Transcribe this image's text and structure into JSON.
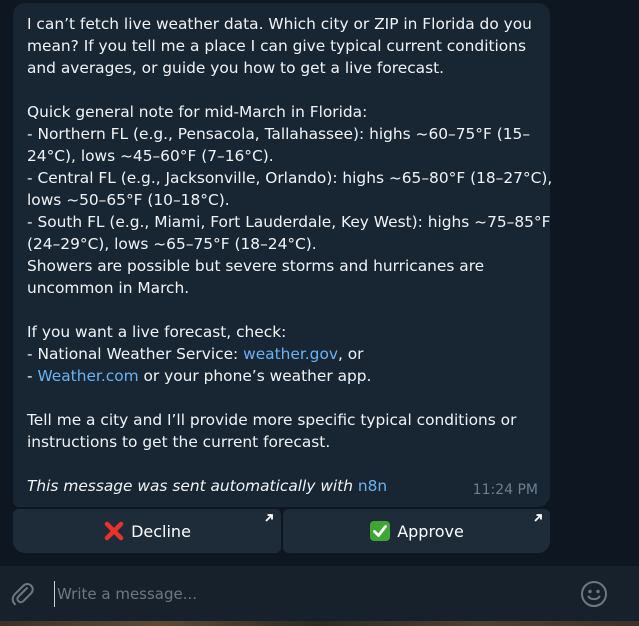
{
  "message": {
    "lines": [
      "I can’t fetch live weather data. Which city or ZIP in Florida do you",
      "mean? If you tell me a place I can give typical current conditions",
      "and averages, or guide you how to get a live forecast.",
      "",
      "Quick general note for mid-March in Florida:",
      "- Northern FL (e.g., Pensacola, Tallahassee): highs ~60–75°F (15–",
      "24°C), lows ~45–60°F (7–16°C).",
      "- Central FL (e.g., Jacksonville, Orlando): highs ~65–80°F (18–27°C),",
      "lows ~50–65°F (10–18°C).",
      "- South FL (e.g., Miami, Fort Lauderdale, Key West): highs ~75–85°F",
      "(24–29°C), lows ~65–75°F (18–24°C).",
      "Showers are possible but severe storms and hurricanes are",
      "uncommon in March.",
      "",
      "If you want a live forecast, check:"
    ],
    "nws_prefix": "- National Weather Service: ",
    "nws_link": "weather.gov",
    "nws_suffix": ", or",
    "wc_prefix": "- ",
    "wc_link": "Weather.com",
    "wc_suffix": " or your phone’s weather app.",
    "closing_lines": [
      "Tell me a city and I’ll provide more specific typical conditions or",
      "instructions to get the current forecast."
    ],
    "footer_text": "This message was sent automatically with ",
    "footer_link": "n8n",
    "time": "11:24 PM"
  },
  "buttons": {
    "decline_label": "Decline",
    "approve_label": "Approve"
  },
  "composer": {
    "placeholder": "Write a message..."
  },
  "colors": {
    "background": "#0e1621",
    "bubble": "#182533",
    "link": "#6ab3f3",
    "decline_icon": "#e8332a",
    "approve_icon": "#3fa535"
  },
  "icons": {
    "decline": "cross-mark-icon",
    "approve": "check-mark-button-icon",
    "button_corner": "arrow-up-right-icon",
    "attach": "paperclip-icon",
    "emoji": "smile-icon"
  }
}
